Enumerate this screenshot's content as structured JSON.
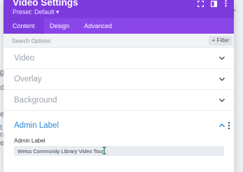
{
  "modal": {
    "title": "Video Settings",
    "preset": "Preset: Default ▾",
    "header_icons": [
      "expand-icon",
      "columns-icon",
      "more-options-icon"
    ]
  },
  "tabs": [
    {
      "label": "Content",
      "active": true
    },
    {
      "label": "Design",
      "active": false
    },
    {
      "label": "Advanced",
      "active": false
    }
  ],
  "search": {
    "placeholder": "Search Options"
  },
  "filter": {
    "label": "+ Filter"
  },
  "sections": [
    {
      "label": "Video",
      "expanded": false
    },
    {
      "label": "Overlay",
      "expanded": false
    },
    {
      "label": "Background",
      "expanded": false
    },
    {
      "label": "Admin Label",
      "expanded": true
    }
  ],
  "admin_label": {
    "field_label": "Admin Label",
    "value": "Weiss Community Library Video Tour"
  },
  "background_fragments": [
    "g",
    "l",
    "d",
    "e",
    "t",
    "ra",
    "e"
  ],
  "colors": {
    "header": "#7d3bdd",
    "tabs": "#8b46ea",
    "accent": "#2b87da",
    "cursor": "#1f8a5b"
  }
}
